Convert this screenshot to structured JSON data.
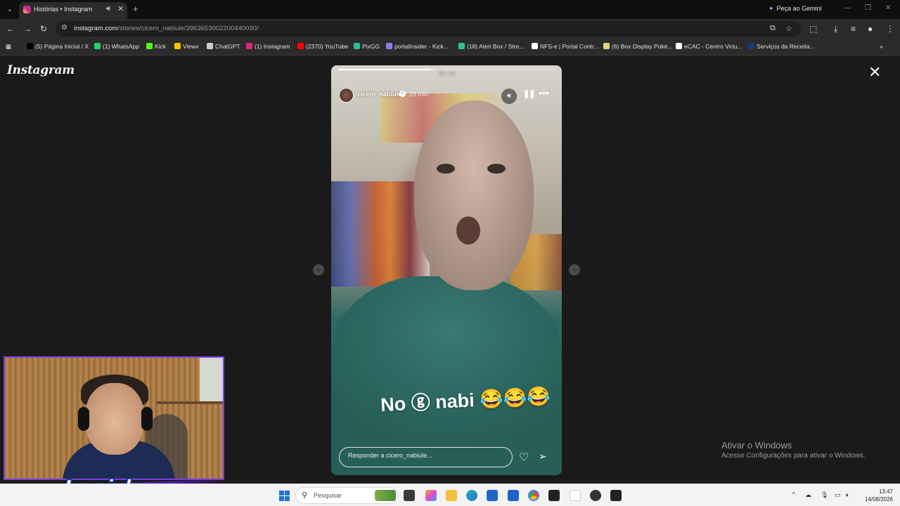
{
  "browser": {
    "tab": {
      "title": "Histórias • Instagram"
    },
    "gemini_label": "Peça ao Gemini",
    "url_host": "instagram.com",
    "url_path": "/stories/cicero_nabiule/3963653002200440030/",
    "bookmarks": [
      {
        "label": "(5) Página Inicial / X",
        "icon_color": "#000000"
      },
      {
        "label": "(1) WhatsApp",
        "icon_color": "#25d366"
      },
      {
        "label": "Kick",
        "icon_color": "#53fc18"
      },
      {
        "label": "Viewx",
        "icon_color": "#f5c400"
      },
      {
        "label": "ChatGPT",
        "icon_color": "#cfcfcf"
      },
      {
        "label": "(1) Instagram",
        "icon_color": "#d62976"
      },
      {
        "label": "(2370) YouTube",
        "icon_color": "#ff0000"
      },
      {
        "label": "PixGG",
        "icon_color": "#2dbf9a"
      },
      {
        "label": "portalinsider - Kick...",
        "icon_color": "#8a7cf0"
      },
      {
        "label": "(18) Alert Box / Stre...",
        "icon_color": "#31c48d"
      },
      {
        "label": "NFS-e | Portal Contr...",
        "icon_color": "#ffffff"
      },
      {
        "label": "(6) Box Display Poké...",
        "icon_color": "#e6d27a"
      },
      {
        "label": "eCAC - Centro Virtu...",
        "icon_color": "#ffffff"
      },
      {
        "label": "Serviços da Receita...",
        "icon_color": "#1a3a7a"
      }
    ]
  },
  "instagram": {
    "logo": "Instagram",
    "story": {
      "counter": "12 / 14",
      "progress": 0.43,
      "username": "cicero_nabiule",
      "time": "29 min",
      "caption": "No ⓖ nabi 😂😂😂",
      "reply_placeholder": "Responder a cicero_nabiule..."
    }
  },
  "windows_activation": {
    "title": "Ativar o Windows",
    "subtitle": "Acesse Configurações para ativar o Windows."
  },
  "overlay": {
    "brand": "Insider"
  },
  "taskbar": {
    "search_placeholder": "Pesquisar",
    "time": "13:47",
    "date": "14/08/2026"
  }
}
